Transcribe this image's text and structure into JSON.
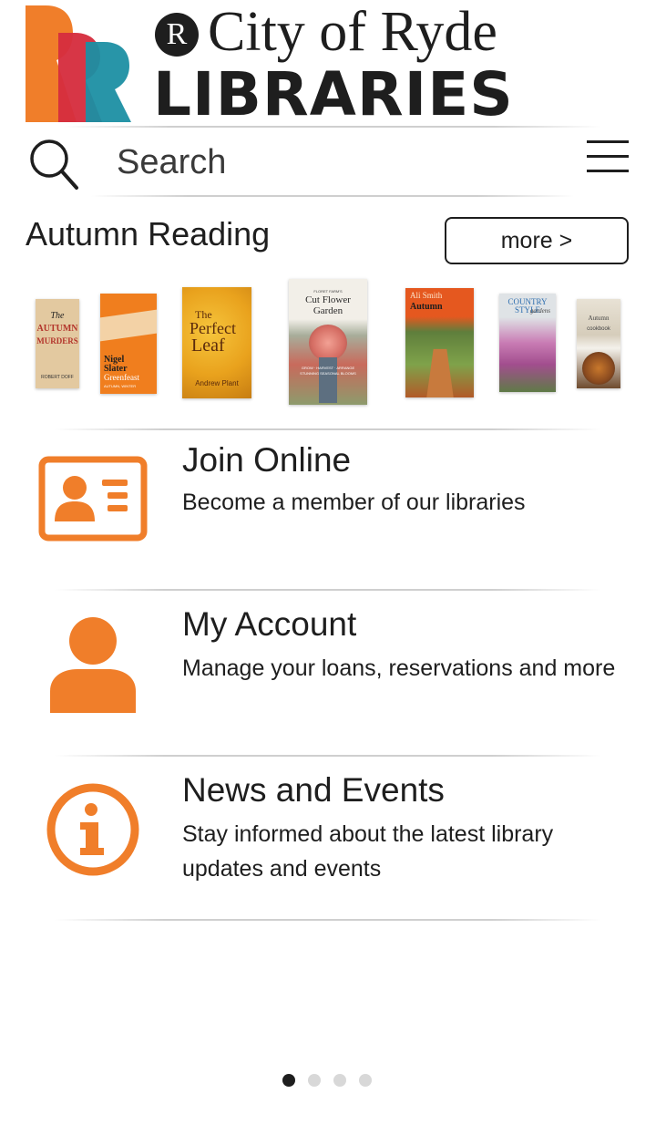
{
  "brand": {
    "badge_letter": "R",
    "city_text": "City of Ryde",
    "libraries_text": "LIBRARIES",
    "colors": {
      "orange": "#f07e2a",
      "red": "#d52e3e",
      "teal": "#1c8fa3"
    }
  },
  "search": {
    "placeholder": "Search"
  },
  "featured": {
    "title": "Autumn Reading",
    "more_label": "more >",
    "books": [
      {
        "lines": [
          "The",
          "AUTUMN",
          "MURDERS",
          "ROBERT DOFF"
        ]
      },
      {
        "lines": [
          "Nigel",
          "Slater",
          "Greenfeast",
          "AUTUMN, WINTER"
        ]
      },
      {
        "lines": [
          "The",
          "Perfect",
          "Leaf",
          "Andrew Plant"
        ]
      },
      {
        "lines": [
          "FLORET FARM'S",
          "Cut Flower",
          "Garden",
          "GROW · HARVEST · ARRANGE",
          "STUNNING SEASONAL BLOOMS"
        ]
      },
      {
        "lines": [
          "Ali Smith",
          "Autumn"
        ]
      },
      {
        "lines": [
          "COUNTRY STYLE",
          "gardens"
        ]
      },
      {
        "lines": [
          "Autumn",
          "cookbook"
        ]
      }
    ]
  },
  "menu": [
    {
      "title": "Join Online",
      "description": "Become a member of our libraries",
      "icon": "member-card-icon"
    },
    {
      "title": "My Account",
      "description": "Manage your loans, reservations and more",
      "icon": "person-icon"
    },
    {
      "title": "News and Events",
      "description": "Stay informed about the latest library updates and events",
      "icon": "info-icon"
    }
  ],
  "pager": {
    "pages": 4,
    "active": 1
  },
  "colors": {
    "accent": "#f07e2a",
    "text": "#1e1e1e",
    "divider": "#cfcfcf",
    "dot_inactive": "#d8d8d8"
  }
}
